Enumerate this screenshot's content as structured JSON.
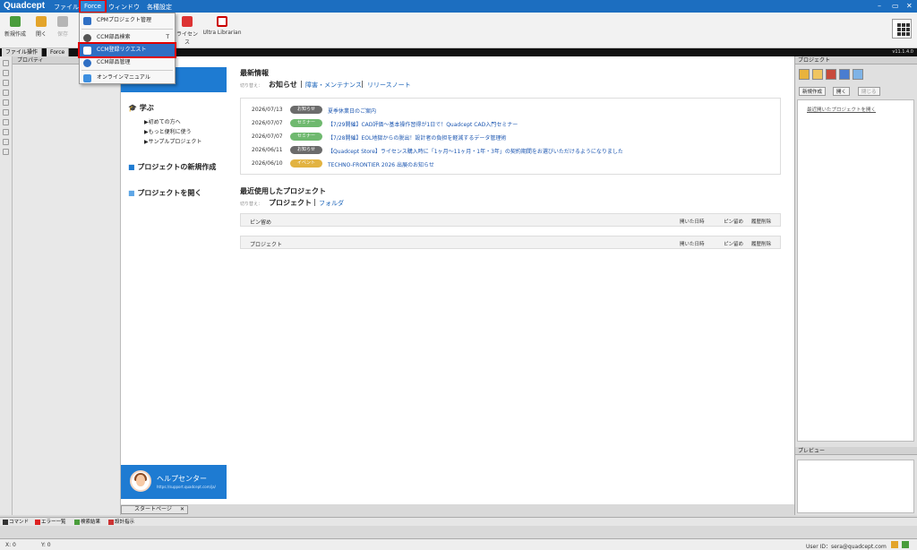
{
  "app": {
    "logo": "Quadcept",
    "version": "v11.1.4.0"
  },
  "menubar": {
    "items": [
      "ファイル",
      "Force",
      "ウィンドウ",
      "各種設定"
    ]
  },
  "window_controls": {
    "minimize": "–",
    "maximize": "▭",
    "close": "✕"
  },
  "toolbar": {
    "new": "新規作成",
    "open": "開く",
    "save": "保存",
    "license": "ライセンス",
    "ultra": "Ultra Librarian"
  },
  "doc_tabs": [
    "ファイル操作",
    "Force"
  ],
  "property_panel": {
    "title": "プロパティ"
  },
  "force_menu": {
    "items": [
      "CPMプロジェクト管理",
      "CCM部品検索",
      "CCM登録リクエスト",
      "CCM部品管理",
      "オンラインマニュアル"
    ],
    "shortcut": "T"
  },
  "nav": {
    "learn": "学ぶ",
    "learn_items": [
      "▶初めての方へ",
      "▶もっと便利に使う",
      "▶サンプルプロジェクト"
    ],
    "new_project": "プロジェクトの新規作成",
    "open_project": "プロジェクトを開く",
    "help": "ヘルプセンター",
    "help_url": "https://support.quadcept.com/ja/"
  },
  "news": {
    "title": "最新情報",
    "switch_label": "切り替え：",
    "tabs": [
      "お知らせ",
      "障害・メンテナンス",
      "リリースノート"
    ],
    "items": [
      {
        "date": "2026/07/13",
        "badge": "お知らせ",
        "badge_color": "#6b6b6b",
        "text": "夏季休業日のご案内"
      },
      {
        "date": "2026/07/07",
        "badge": "セミナー",
        "badge_color": "#6fb96f",
        "text": "【7/29開催】CAD評価～基本操作習得が1日で！Quadcept CAD入門セミナー"
      },
      {
        "date": "2026/07/07",
        "badge": "セミナー",
        "badge_color": "#6fb96f",
        "text": "【7/28開催】EOL地獄からの脱出！設計者の負担を軽減するデータ管理術"
      },
      {
        "date": "2026/06/11",
        "badge": "お知らせ",
        "badge_color": "#6b6b6b",
        "text": "【Quadcept Store】ライセンス購入時に「1ヶ月～11ヶ月・1年・3年」の契約期間をお選びいただけるようになりました"
      },
      {
        "date": "2026/06/10",
        "badge": "イベント",
        "badge_color": "#e2b341",
        "text": "TECHNO-FRONTIER 2026 出展のお知らせ"
      }
    ]
  },
  "recent": {
    "title": "最近使用したプロジェクト",
    "switch_label": "切り替え：",
    "tabs": [
      "プロジェクト",
      "フォルダ"
    ],
    "rows": [
      {
        "label": "ピン留め",
        "cols": [
          "開いた日時",
          "ピン留め",
          "履歴削除"
        ]
      },
      {
        "label": "プロジェクト",
        "cols": [
          "開いた日時",
          "ピン留め",
          "履歴削除"
        ]
      }
    ]
  },
  "right_panel": {
    "title": "プロジェクト",
    "buttons": [
      "新規作成",
      "開く",
      "閉じる"
    ],
    "recent_link": "最近開いたプロジェクトを開く",
    "preview": "プレビュー"
  },
  "start_tab": {
    "label": "スタートページ",
    "close": "✕"
  },
  "bottom_tabs": [
    "コマンド",
    "エラー一覧",
    "検索結果",
    "設計指示"
  ],
  "status": {
    "x": "X: 0",
    "y": "Y: 0",
    "user": "User ID：sera@quadcept.com"
  },
  "colors": {
    "brand": "#1c6ec0",
    "accent_red": "#e00000"
  }
}
